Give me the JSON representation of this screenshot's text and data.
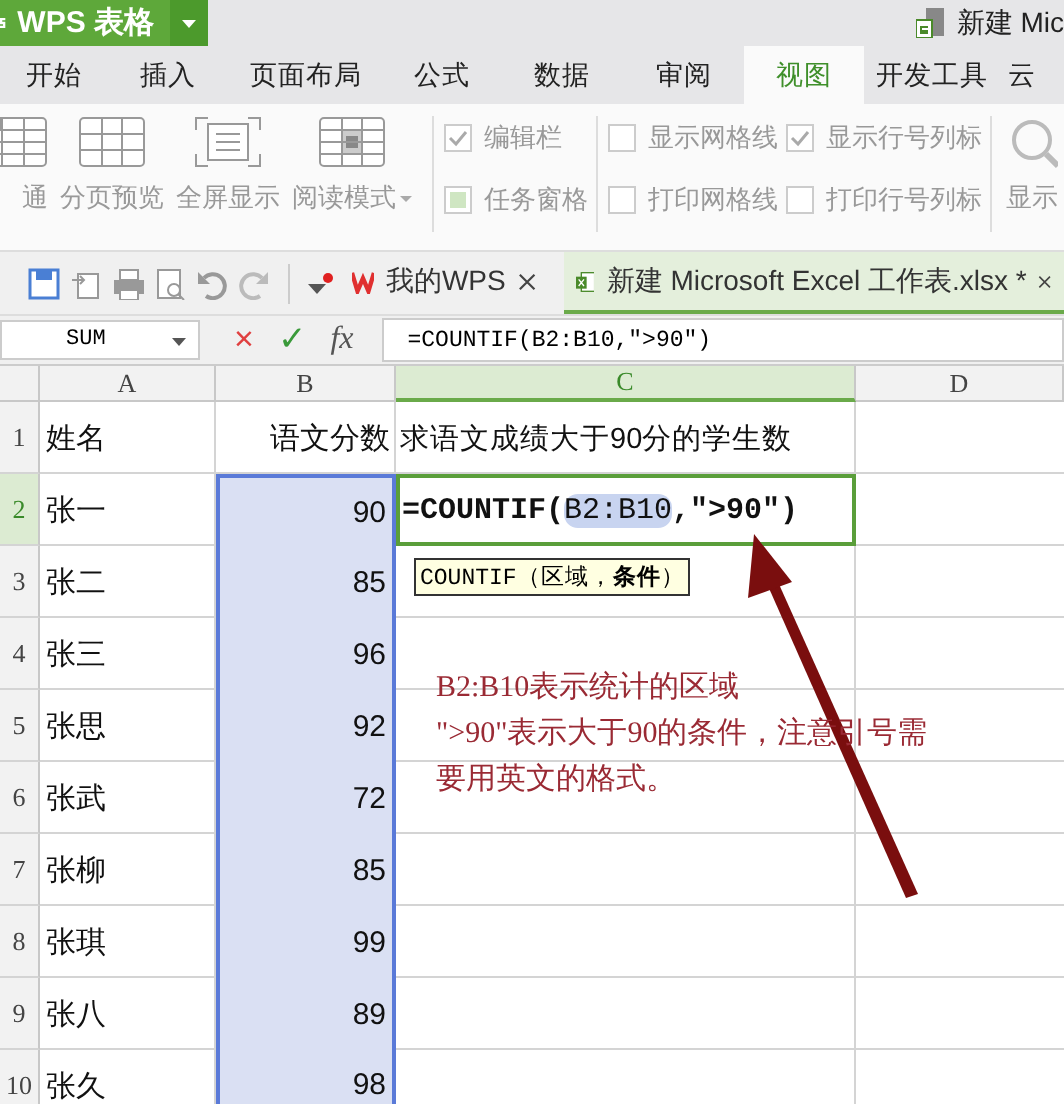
{
  "app": {
    "title": "WPS 表格",
    "document_title": "新建 Mic"
  },
  "menu_tabs": [
    {
      "label": "开始",
      "selected": false
    },
    {
      "label": "插入",
      "selected": false
    },
    {
      "label": "页面布局",
      "selected": false
    },
    {
      "label": "公式",
      "selected": false
    },
    {
      "label": "数据",
      "selected": false
    },
    {
      "label": "审阅",
      "selected": false
    },
    {
      "label": "视图",
      "selected": true
    },
    {
      "label": "开发工具",
      "selected": false
    },
    {
      "label": "云",
      "selected": false
    }
  ],
  "ribbon": {
    "view_buttons": [
      {
        "label": "通",
        "kind": "normal",
        "has_dropdown": false
      },
      {
        "label": "分页预览",
        "kind": "pagebreak",
        "has_dropdown": false
      },
      {
        "label": "全屏显示",
        "kind": "fullscreen",
        "has_dropdown": false
      },
      {
        "label": "阅读模式",
        "kind": "reading",
        "has_dropdown": true
      }
    ],
    "option_groups": [
      [
        {
          "label": "编辑栏",
          "kind": "checkbox",
          "checked": true
        },
        {
          "label": "任务窗格",
          "kind": "toggle",
          "checked": true
        }
      ],
      [
        {
          "label": "显示网格线",
          "kind": "checkbox",
          "checked": false
        },
        {
          "label": "打印网格线",
          "kind": "checkbox",
          "checked": false
        }
      ],
      [
        {
          "label": "显示行号列标",
          "kind": "checkbox",
          "checked": true
        },
        {
          "label": "打印行号列标",
          "kind": "checkbox",
          "checked": false
        }
      ]
    ],
    "zoom_button": {
      "label": "显示"
    }
  },
  "doc_tabs": [
    {
      "label": "我的WPS",
      "kind": "home",
      "selected": false
    },
    {
      "label": "新建 Microsoft Excel 工作表.xlsx *",
      "kind": "sheet",
      "selected": true
    }
  ],
  "formula_bar": {
    "name_box": "SUM",
    "cancel": "×",
    "confirm": "✓",
    "fx": "fx",
    "formula": "=COUNTIF(B2:B10,\">90\")"
  },
  "sheet": {
    "columns": [
      {
        "label": "A",
        "selected": false
      },
      {
        "label": "B",
        "selected": false
      },
      {
        "label": "C",
        "selected": true
      },
      {
        "label": "D",
        "selected": false
      }
    ],
    "rows": [
      {
        "number": "1",
        "selected": false,
        "in_range": false,
        "a": "姓名",
        "b": "语文分数",
        "c": "求语文成绩大于90分的学生数"
      },
      {
        "number": "2",
        "selected": true,
        "in_range": true,
        "a": "张一",
        "b": "90",
        "c_edit": [
          "=COUNTIF(",
          "B2:B10",
          ",\">90\")"
        ]
      },
      {
        "number": "3",
        "selected": false,
        "in_range": true,
        "a": "张二",
        "b": "85"
      },
      {
        "number": "4",
        "selected": false,
        "in_range": true,
        "a": "张三",
        "b": "96"
      },
      {
        "number": "5",
        "selected": false,
        "in_range": true,
        "a": "张思",
        "b": "92"
      },
      {
        "number": "6",
        "selected": false,
        "in_range": true,
        "a": "张武",
        "b": "72"
      },
      {
        "number": "7",
        "selected": false,
        "in_range": true,
        "a": "张柳",
        "b": "85"
      },
      {
        "number": "8",
        "selected": false,
        "in_range": true,
        "a": "张琪",
        "b": "99"
      },
      {
        "number": "9",
        "selected": false,
        "in_range": true,
        "a": "张八",
        "b": "89"
      },
      {
        "number": "10",
        "selected": false,
        "in_range": true,
        "a": "张久",
        "b": "98"
      }
    ],
    "tooltip": "COUNTIF（区域，**条件**）",
    "note": "B2:B10表示统计的区域\n\">90\"表示大于90的条件，注意引号需要用英文的格式。"
  }
}
